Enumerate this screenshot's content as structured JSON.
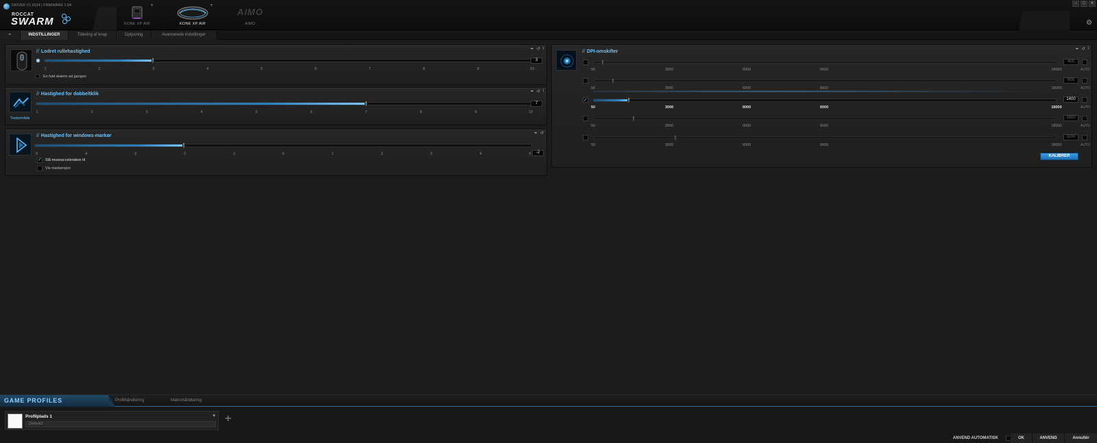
{
  "app": {
    "driver_info": "DRIVER V1.9024 | FIRMWARE 1.04",
    "brand_small": "ROCCAT",
    "brand_big": "SWARM",
    "window_controls": [
      "–",
      "□",
      "✕"
    ]
  },
  "devices": [
    {
      "label": "KONE XP AIR",
      "icon": "dock-icon",
      "active": false
    },
    {
      "label": "KONE XP AIR",
      "icon": "mouse-icon",
      "active": true
    },
    {
      "label": "AIMO",
      "logo": "AIMO",
      "active": false
    }
  ],
  "tabs": [
    "",
    "INDSTILLINGER",
    "Tildeling af knap",
    "Oplysning",
    "Avancerede indstillinger"
  ],
  "panels": {
    "scroll": {
      "title": "Lodret rullehastighed",
      "ticks": [
        "1",
        "2",
        "3",
        "4",
        "5",
        "6",
        "7",
        "8",
        "9",
        "10"
      ],
      "value": "3",
      "level": 3,
      "min": 1,
      "max": 10,
      "option": "En fuld skærm ad gangen"
    },
    "doubleclick": {
      "title": "Hastighed for dobbeltklik",
      "thumb_label": "Testområde",
      "ticks": [
        "1",
        "2",
        "3",
        "4",
        "5",
        "6",
        "7",
        "8",
        "9",
        "10"
      ],
      "value": "7",
      "level": 7,
      "min": 1,
      "max": 10
    },
    "pointer": {
      "title": "Hastighed for windows-markør",
      "ticks": [
        "-5",
        "-4",
        "-3",
        "-2",
        "-1",
        "0",
        "1",
        "2",
        "3",
        "4",
        "5"
      ],
      "value": "-2",
      "level": -2,
      "min": -5,
      "max": 5,
      "accel_label": "Slå museacceleration til",
      "accel_checked": true,
      "trails_label": "Vis markørspor",
      "trails_checked": false
    },
    "dpi": {
      "title": "DPI-omskifter",
      "ticks": [
        "50",
        "3000",
        "6000",
        "9000",
        "18000"
      ],
      "auto_label": "AUTO",
      "calibrate_label": "KALIBRER",
      "rows": [
        {
          "value": "400",
          "dpi": 400,
          "enabled": false,
          "selected": false
        },
        {
          "value": "800",
          "dpi": 800,
          "enabled": false,
          "selected": false
        },
        {
          "value": "1400",
          "dpi": 1400,
          "enabled": true,
          "selected": true
        },
        {
          "value": "1600",
          "dpi": 1600,
          "enabled": false,
          "selected": false
        },
        {
          "value": "3200",
          "dpi": 3200,
          "enabled": false,
          "selected": false
        }
      ]
    }
  },
  "bottom": {
    "title": "GAME PROFILES",
    "tabs": [
      "Profilhåndtering",
      "Makrohåndtering"
    ],
    "profile_name": "Profilplads 1",
    "profile_sub": "Default2",
    "apply_auto_label": "ANVEND AUTOMATISK",
    "buttons": [
      "OK",
      "ANVEND",
      "Annullér"
    ]
  },
  "colors": {
    "accent": "#6fc0f5",
    "fill": "#2c7fbf",
    "background": "#1c1c1c"
  }
}
